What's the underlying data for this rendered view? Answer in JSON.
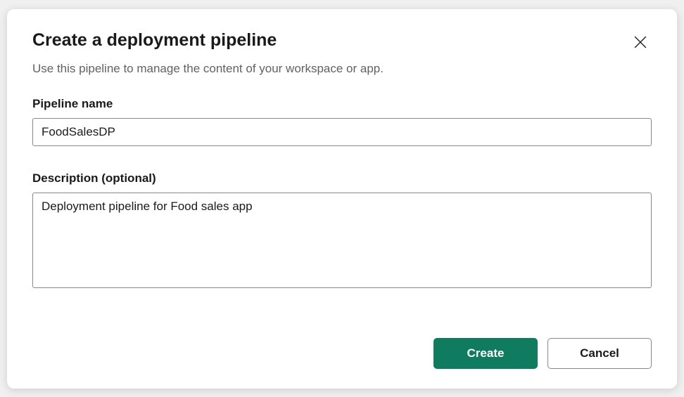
{
  "dialog": {
    "title": "Create a deployment pipeline",
    "subtitle": "Use this pipeline to manage the content of your workspace or app."
  },
  "form": {
    "name_label": "Pipeline name",
    "name_value": "FoodSalesDP",
    "description_label": "Description (optional)",
    "description_value": "Deployment pipeline for Food sales app"
  },
  "buttons": {
    "create": "Create",
    "cancel": "Cancel"
  }
}
